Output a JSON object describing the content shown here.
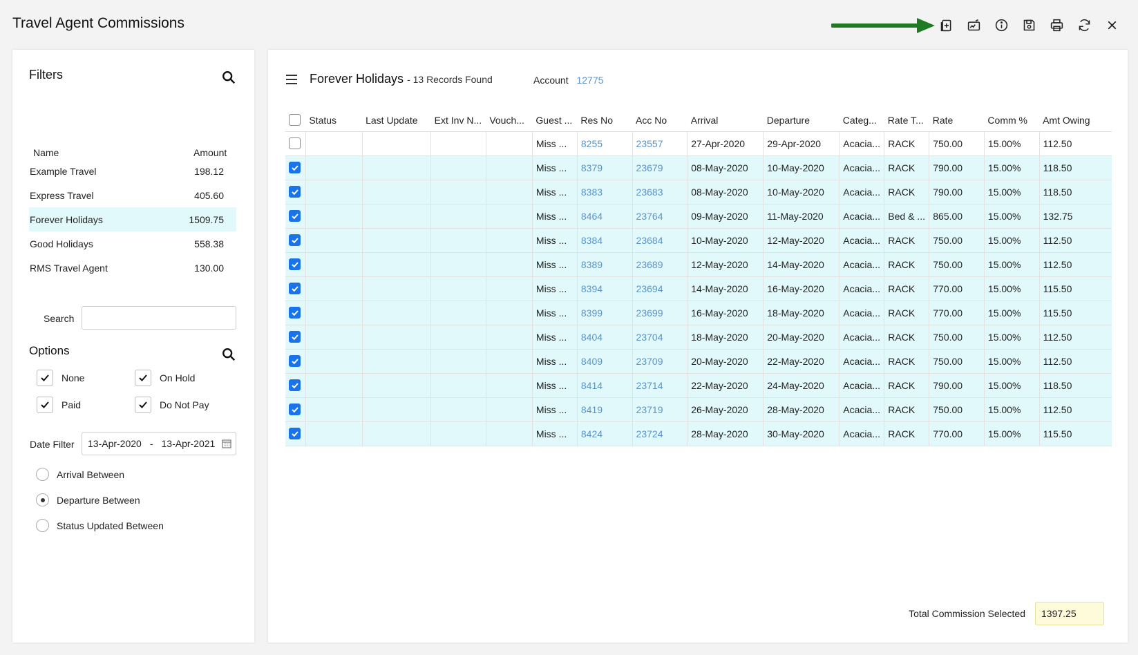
{
  "title": "Travel Agent Commissions",
  "toolbar": [
    {
      "name": "add-document-icon"
    },
    {
      "name": "sign-icon"
    },
    {
      "name": "info-icon"
    },
    {
      "name": "save-icon"
    },
    {
      "name": "print-icon"
    },
    {
      "name": "refresh-icon"
    },
    {
      "name": "close-icon"
    }
  ],
  "filters": {
    "heading": "Filters",
    "col_name": "Name",
    "col_amount": "Amount",
    "agents": [
      {
        "name": "Example Travel",
        "amount": "198.12"
      },
      {
        "name": "Express Travel",
        "amount": "405.60"
      },
      {
        "name": "Forever Holidays",
        "amount": "1509.75",
        "selected": true
      },
      {
        "name": "Good Holidays",
        "amount": "558.38"
      },
      {
        "name": "RMS Travel Agent",
        "amount": "130.00"
      }
    ],
    "search_label": "Search",
    "search_value": ""
  },
  "options": {
    "heading": "Options",
    "none": "None",
    "on_hold": "On Hold",
    "paid": "Paid",
    "do_not_pay": "Do Not Pay",
    "date_filter_label": "Date Filter",
    "date_from": "13-Apr-2020",
    "date_sep": "-",
    "date_to": "13-Apr-2021",
    "radio_arrival": "Arrival Between",
    "radio_departure": "Departure Between",
    "radio_status": "Status Updated Between"
  },
  "main": {
    "agent_title": "Forever Holidays",
    "records": "- 13 Records Found",
    "account_label": "Account",
    "account_value": "12775",
    "columns": [
      "Status",
      "Last Update",
      "Ext Inv N...",
      "Vouch...",
      "Guest ...",
      "Res No",
      "Acc No",
      "Arrival",
      "Departure",
      "Categ...",
      "Rate T...",
      "Rate",
      "Comm %",
      "Amt Owing"
    ],
    "rows": [
      {
        "checked": false,
        "guest": "Miss ...",
        "res": "8255",
        "acc": "23557",
        "arrival": "27-Apr-2020",
        "departure": "29-Apr-2020",
        "cat": "Acacia...",
        "rate_type": "RACK",
        "rate": "750.00",
        "comm": "15.00%",
        "owing": "112.50"
      },
      {
        "checked": true,
        "guest": "Miss ...",
        "res": "8379",
        "acc": "23679",
        "arrival": "08-May-2020",
        "departure": "10-May-2020",
        "cat": "Acacia...",
        "rate_type": "RACK",
        "rate": "790.00",
        "comm": "15.00%",
        "owing": "118.50"
      },
      {
        "checked": true,
        "guest": "Miss ...",
        "res": "8383",
        "acc": "23683",
        "arrival": "08-May-2020",
        "departure": "10-May-2020",
        "cat": "Acacia...",
        "rate_type": "RACK",
        "rate": "790.00",
        "comm": "15.00%",
        "owing": "118.50"
      },
      {
        "checked": true,
        "guest": "Miss ...",
        "res": "8464",
        "acc": "23764",
        "arrival": "09-May-2020",
        "departure": "11-May-2020",
        "cat": "Acacia...",
        "rate_type": "Bed & ...",
        "rate": "865.00",
        "comm": "15.00%",
        "owing": "132.75"
      },
      {
        "checked": true,
        "guest": "Miss ...",
        "res": "8384",
        "acc": "23684",
        "arrival": "10-May-2020",
        "departure": "12-May-2020",
        "cat": "Acacia...",
        "rate_type": "RACK",
        "rate": "750.00",
        "comm": "15.00%",
        "owing": "112.50"
      },
      {
        "checked": true,
        "guest": "Miss ...",
        "res": "8389",
        "acc": "23689",
        "arrival": "12-May-2020",
        "departure": "14-May-2020",
        "cat": "Acacia...",
        "rate_type": "RACK",
        "rate": "750.00",
        "comm": "15.00%",
        "owing": "112.50"
      },
      {
        "checked": true,
        "guest": "Miss ...",
        "res": "8394",
        "acc": "23694",
        "arrival": "14-May-2020",
        "departure": "16-May-2020",
        "cat": "Acacia...",
        "rate_type": "RACK",
        "rate": "770.00",
        "comm": "15.00%",
        "owing": "115.50"
      },
      {
        "checked": true,
        "guest": "Miss ...",
        "res": "8399",
        "acc": "23699",
        "arrival": "16-May-2020",
        "departure": "18-May-2020",
        "cat": "Acacia...",
        "rate_type": "RACK",
        "rate": "770.00",
        "comm": "15.00%",
        "owing": "115.50"
      },
      {
        "checked": true,
        "guest": "Miss ...",
        "res": "8404",
        "acc": "23704",
        "arrival": "18-May-2020",
        "departure": "20-May-2020",
        "cat": "Acacia...",
        "rate_type": "RACK",
        "rate": "750.00",
        "comm": "15.00%",
        "owing": "112.50"
      },
      {
        "checked": true,
        "guest": "Miss ...",
        "res": "8409",
        "acc": "23709",
        "arrival": "20-May-2020",
        "departure": "22-May-2020",
        "cat": "Acacia...",
        "rate_type": "RACK",
        "rate": "750.00",
        "comm": "15.00%",
        "owing": "112.50"
      },
      {
        "checked": true,
        "guest": "Miss ...",
        "res": "8414",
        "acc": "23714",
        "arrival": "22-May-2020",
        "departure": "24-May-2020",
        "cat": "Acacia...",
        "rate_type": "RACK",
        "rate": "790.00",
        "comm": "15.00%",
        "owing": "118.50"
      },
      {
        "checked": true,
        "guest": "Miss ...",
        "res": "8419",
        "acc": "23719",
        "arrival": "26-May-2020",
        "departure": "28-May-2020",
        "cat": "Acacia...",
        "rate_type": "RACK",
        "rate": "750.00",
        "comm": "15.00%",
        "owing": "112.50"
      },
      {
        "checked": true,
        "guest": "Miss ...",
        "res": "8424",
        "acc": "23724",
        "arrival": "28-May-2020",
        "departure": "30-May-2020",
        "cat": "Acacia...",
        "rate_type": "RACK",
        "rate": "770.00",
        "comm": "15.00%",
        "owing": "115.50"
      }
    ],
    "total_label": "Total Commission Selected",
    "total_value": "1397.25"
  },
  "colors": {
    "accent": "#1a73e8",
    "link": "#5b93c7",
    "row_highlight": "#e1f9fb",
    "arrow": "#1f7a22"
  }
}
